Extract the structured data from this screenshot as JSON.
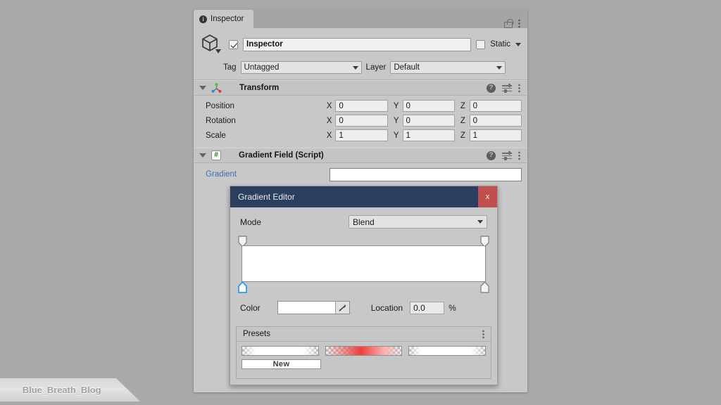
{
  "inspector": {
    "tab_label": "Inspector",
    "tab_icon": "info-icon",
    "lock_icon": "lock-open-icon",
    "menu_icon": "kebab-menu-icon",
    "object": {
      "icon": "cube-icon",
      "enabled_checkbox": true,
      "name_value": "Inspector",
      "static_checkbox": false,
      "static_label": "Static",
      "tag_label": "Tag",
      "tag_value": "Untagged",
      "layer_label": "Layer",
      "layer_value": "Default"
    },
    "transform": {
      "title": "Transform",
      "icon": "transform-gizmo-icon",
      "rows": [
        {
          "name": "Position",
          "x": "0",
          "y": "0",
          "z": "0"
        },
        {
          "name": "Rotation",
          "x": "0",
          "y": "0",
          "z": "0"
        },
        {
          "name": "Scale",
          "x": "1",
          "y": "1",
          "z": "1"
        }
      ],
      "axes": {
        "x": "X",
        "y": "Y",
        "z": "Z"
      }
    },
    "script_component": {
      "title": "Gradient Field (Script)",
      "icon": "csharp-script-icon",
      "field_label": "Gradient",
      "field_value": ""
    }
  },
  "gradient_editor": {
    "title": "Gradient Editor",
    "close_label": "x",
    "mode_label": "Mode",
    "mode_value": "Blend",
    "gradient_preview_color": "#ffffff",
    "markers": {
      "alpha_left": {
        "position": 0,
        "selected": false
      },
      "alpha_right": {
        "position": 100,
        "selected": false
      },
      "color_left": {
        "position": 0,
        "selected": true
      },
      "color_right": {
        "position": 100,
        "selected": false
      }
    },
    "color_label": "Color",
    "color_value": "#ffffff",
    "eyedropper_icon": "eyedropper-icon",
    "location_label": "Location",
    "location_value": "0.0",
    "location_unit": "%",
    "presets": {
      "title": "Presets",
      "menu_icon": "kebab-menu-icon",
      "items": [
        {
          "name": "white-gradient-preset",
          "css": "linear-gradient(to right, rgba(255,255,255,0) 0%, rgba(255,255,255,1) 18%, rgba(255,255,255,1) 80%, rgba(255,255,255,0) 100%)"
        },
        {
          "name": "red-gradient-preset",
          "css": "linear-gradient(to right, rgba(242,92,92,0) 0%, rgba(242,92,92,0.55) 22%, rgba(239,62,62,1) 46%, rgba(250,180,180,1) 78%, rgba(255,255,255,0) 100%)"
        },
        {
          "name": "white-gradient-preset-2",
          "css": "linear-gradient(to right, rgba(255,255,255,0) 0%, rgba(255,255,255,1) 16%, rgba(255,255,255,1) 82%, rgba(255,255,255,0) 100%)"
        }
      ],
      "new_button_label": "New"
    }
  },
  "watermark": {
    "text": "Blue_Breath_Blog"
  }
}
